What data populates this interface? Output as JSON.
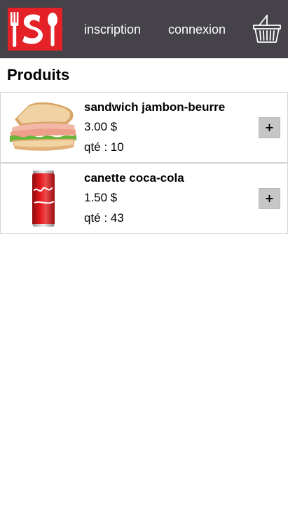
{
  "header": {
    "logo_alt": "S",
    "nav": [
      {
        "label": "inscription"
      },
      {
        "label": "connexion"
      }
    ],
    "basket_icon": "basket-icon"
  },
  "page": {
    "title": "Produits"
  },
  "products": [
    {
      "name": "sandwich jambon-beurre",
      "price": "3.00 $",
      "qty": "qté : 10",
      "add_label": "+",
      "image_icon": "sandwich-image"
    },
    {
      "name": "canette coca-cola",
      "price": "1.50 $",
      "qty": "qté : 43",
      "add_label": "+",
      "image_icon": "coca-cola-can-image"
    }
  ],
  "colors": {
    "header_bg": "#45424a",
    "logo_red": "#e32127",
    "button_bg": "#c6c6c6"
  }
}
